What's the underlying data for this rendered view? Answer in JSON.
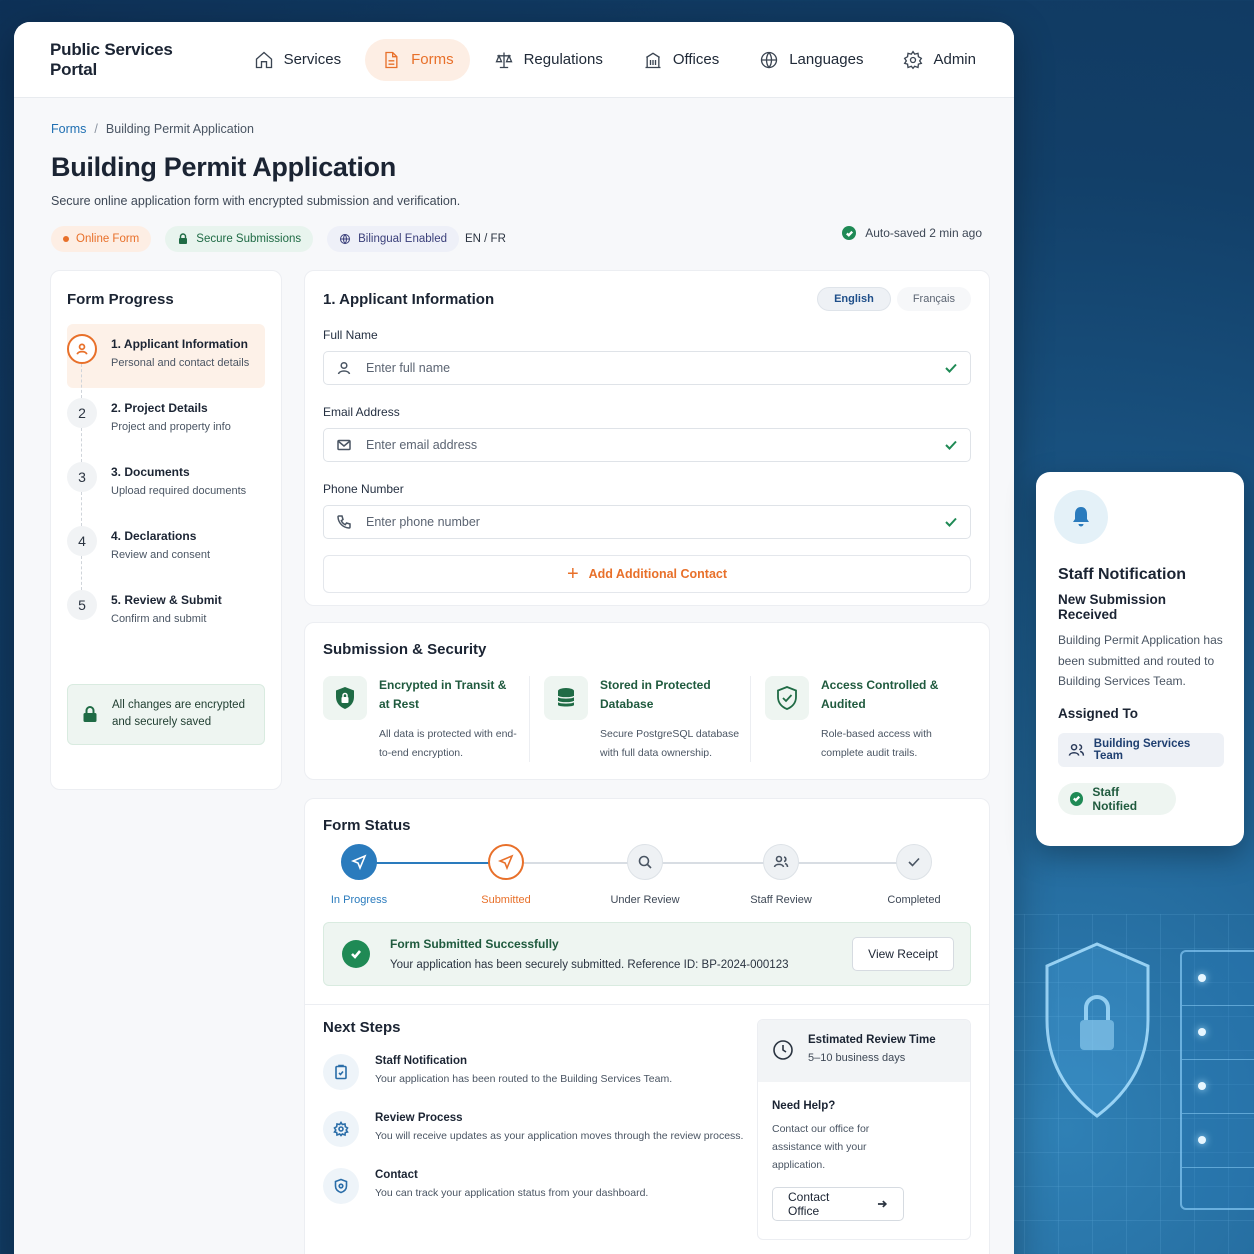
{
  "header": {
    "brand": "Public Services Portal",
    "nav": [
      {
        "label": "Services",
        "icon": "home-icon"
      },
      {
        "label": "Forms",
        "icon": "document-icon",
        "active": true
      },
      {
        "label": "Regulations",
        "icon": "scales-icon"
      },
      {
        "label": "Offices",
        "icon": "building-icon"
      },
      {
        "label": "Languages",
        "icon": "globe-icon"
      },
      {
        "label": "Admin",
        "icon": "gear-icon"
      }
    ]
  },
  "breadcrumb": {
    "parent": "Forms",
    "separator": "/",
    "current": "Building Permit Application"
  },
  "page": {
    "title": "Building Permit Application",
    "subtitle": "Secure online application form with encrypted submission and verification.",
    "tags": {
      "online": "Online Form",
      "secure": "Secure Submissions",
      "bilingual": "Bilingual Enabled",
      "lang_codes": "EN / FR"
    },
    "autosave": "Auto-saved 2 min ago"
  },
  "progress": {
    "title": "Form Progress",
    "steps": [
      {
        "num": "1",
        "title": "1. Applicant Information",
        "desc": "Personal and contact details"
      },
      {
        "num": "2",
        "title": "2. Project Details",
        "desc": "Project and property info"
      },
      {
        "num": "3",
        "title": "3. Documents",
        "desc": "Upload required documents"
      },
      {
        "num": "4",
        "title": "4. Declarations",
        "desc": "Review and consent"
      },
      {
        "num": "5",
        "title": "5. Review & Submit",
        "desc": "Confirm and submit"
      }
    ],
    "encrypted_note": "All changes are encrypted and securely saved"
  },
  "applicant": {
    "title": "1.  Applicant Information",
    "lang_en": "English",
    "lang_fr": "Français",
    "full_name": {
      "label": "Full Name",
      "placeholder": "Enter full name"
    },
    "email": {
      "label": "Email Address",
      "placeholder": "Enter email address"
    },
    "phone": {
      "label": "Phone Number",
      "placeholder": "Enter phone number"
    },
    "add_contact": "Add Additional Contact"
  },
  "security": {
    "title": "Submission & Security",
    "items": [
      {
        "title": "Encrypted in Transit & at Rest",
        "desc": "All data is protected with end-to-end encryption.",
        "icon": "shield-lock-icon"
      },
      {
        "title": "Stored in Protected Database",
        "desc": "Secure PostgreSQL database with full data ownership.",
        "icon": "database-icon"
      },
      {
        "title": "Access Controlled & Audited",
        "desc": "Role-based access with complete audit trails.",
        "icon": "shield-check-icon"
      }
    ]
  },
  "status": {
    "title": "Form Status",
    "stages": [
      "In Progress",
      "Submitted",
      "Under Review",
      "Staff Review",
      "Completed"
    ],
    "success_title": "Form Submitted Successfully",
    "success_desc": "Your application has been securely submitted. Reference ID: BP-2024-000123",
    "view_receipt": "View Receipt"
  },
  "next_steps": {
    "title": "Next Steps",
    "items": [
      {
        "title": "Staff Notification",
        "desc": "Your application has been routed to the Building Services Team."
      },
      {
        "title": "Review Process",
        "desc": "You will receive updates as your application moves through the review process."
      },
      {
        "title": "Contact",
        "desc": "You can track your application status from your dashboard."
      }
    ],
    "estimate_title": "Estimated Review Time",
    "estimate_value": "5–10 business days",
    "help_title": "Need Help?",
    "help_desc": "Contact our office for assistance with your application.",
    "contact_button": "Contact Office"
  },
  "notification": {
    "title": "Staff Notification",
    "subtitle": "New Submission Received",
    "desc": "Building Permit Application has been submitted and routed to Building Services Team.",
    "assigned_label": "Assigned To",
    "team": "Building Services Team",
    "status": "Staff Notified"
  },
  "colors": {
    "accent": "#e8702a",
    "primary": "#2a7bbd",
    "success": "#1f8a55"
  }
}
